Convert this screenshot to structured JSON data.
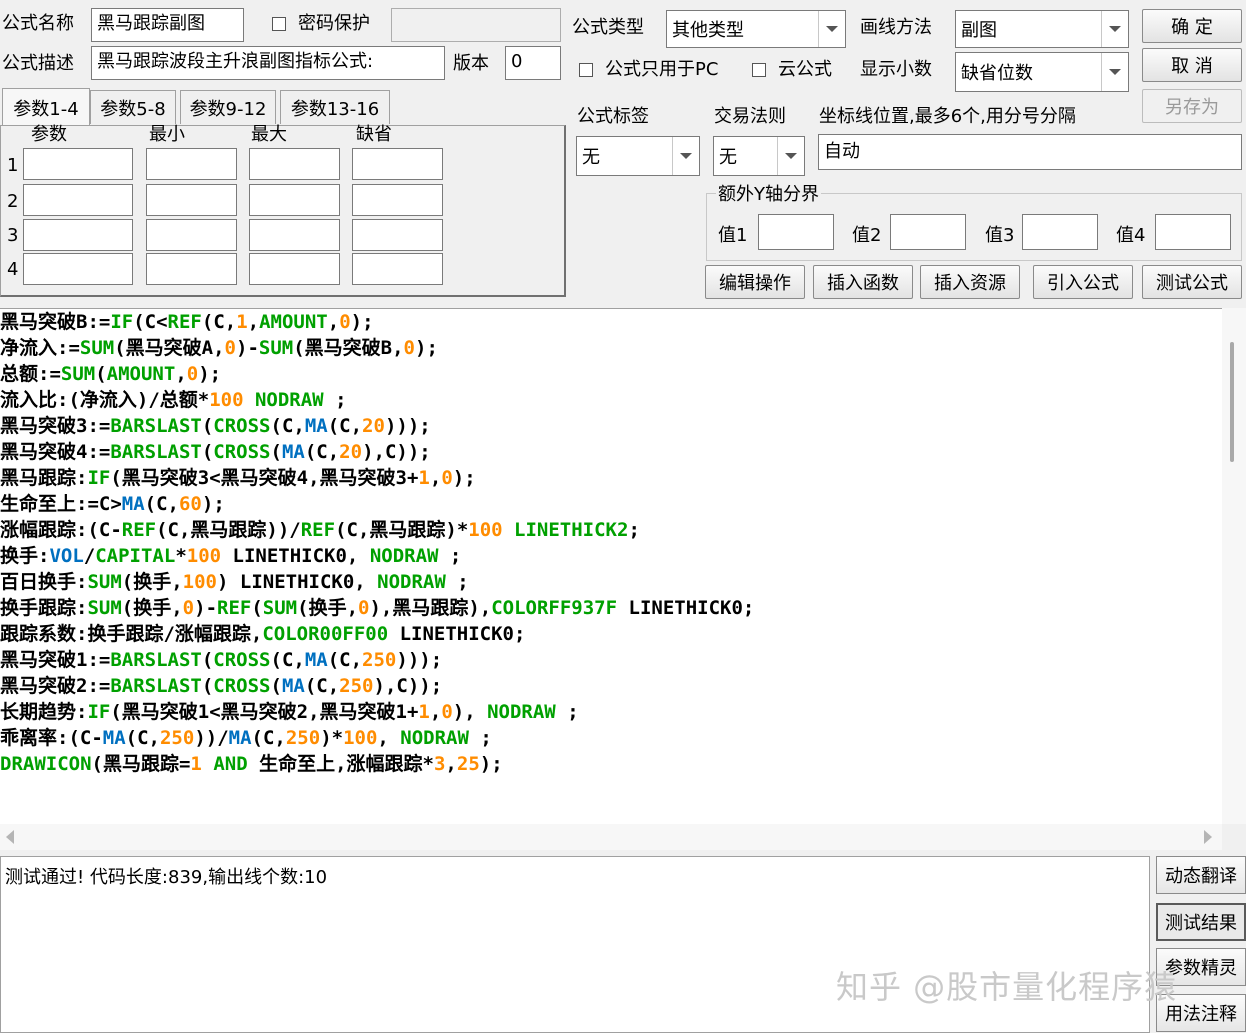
{
  "top": {
    "name_label": "公式名称",
    "name_value": "黑马跟踪副图",
    "password_label": "密码保护",
    "password_checked": false,
    "desc_label": "公式描述",
    "desc_value": "黑马跟踪波段主升浪副图指标公式:",
    "version_label": "版本",
    "version_value": "0",
    "type_label": "公式类型",
    "type_value": "其他类型",
    "draw_label": "画线方法",
    "draw_value": "副图",
    "pc_only_label": "公式只用于PC",
    "pc_only_checked": false,
    "cloud_label": "云公式",
    "cloud_checked": false,
    "decimal_label": "显示小数",
    "decimal_value": "缺省位数",
    "ok_label": "确  定",
    "cancel_label": "取  消",
    "saveas_label": "另存为"
  },
  "tabs": [
    "参数1-4",
    "参数5-8",
    "参数9-12",
    "参数13-16"
  ],
  "params": {
    "headers": [
      "参数",
      "最小",
      "最大",
      "缺省"
    ],
    "rows": [
      "1",
      "2",
      "3",
      "4"
    ]
  },
  "right": {
    "tag_label": "公式标签",
    "tag_value": "无",
    "rule_label": "交易法则",
    "rule_value": "无",
    "axis_label": "坐标线位置,最多6个,用分号分隔",
    "axis_value": "自动",
    "extra_y_label": "额外Y轴分界",
    "v1_label": "值1",
    "v2_label": "值2",
    "v3_label": "值3",
    "v4_label": "值4"
  },
  "actions": [
    "编辑操作",
    "插入函数",
    "插入资源",
    "引入公式",
    "测试公式"
  ],
  "colors": {
    "keyword": "#00a000",
    "number": "#ff8c00",
    "func_blue": "#0070c0",
    "text": "#000000"
  },
  "code": [
    [
      [
        "黑马突破B:=",
        "t"
      ],
      [
        "IF",
        "k"
      ],
      [
        "(C<",
        "t"
      ],
      [
        "REF",
        "k"
      ],
      [
        "(C,",
        "t"
      ],
      [
        "1",
        "n"
      ],
      [
        ",",
        "t"
      ],
      [
        "AMOUNT",
        "k"
      ],
      [
        ",",
        "t"
      ],
      [
        "0",
        "n"
      ],
      [
        ");",
        "t"
      ]
    ],
    [
      [
        "净流入:=",
        "t"
      ],
      [
        "SUM",
        "k"
      ],
      [
        "(黑马突破A,",
        "t"
      ],
      [
        "0",
        "n"
      ],
      [
        ")-",
        "t"
      ],
      [
        "SUM",
        "k"
      ],
      [
        "(黑马突破B,",
        "t"
      ],
      [
        "0",
        "n"
      ],
      [
        ");",
        "t"
      ]
    ],
    [
      [
        "总额:=",
        "t"
      ],
      [
        "SUM",
        "k"
      ],
      [
        "(",
        "t"
      ],
      [
        "AMOUNT",
        "k"
      ],
      [
        ",",
        "t"
      ],
      [
        "0",
        "n"
      ],
      [
        ");",
        "t"
      ]
    ],
    [
      [
        "流入比:(净流入)/总额*",
        "t"
      ],
      [
        "100",
        "n"
      ],
      [
        " ",
        "t"
      ],
      [
        "NODRAW",
        "k"
      ],
      [
        " ;",
        "t"
      ]
    ],
    [
      [
        "黑马突破3:=",
        "t"
      ],
      [
        "BARSLAST",
        "k"
      ],
      [
        "(",
        "t"
      ],
      [
        "CROSS",
        "k"
      ],
      [
        "(C,",
        "t"
      ],
      [
        "MA",
        "b"
      ],
      [
        "(C,",
        "t"
      ],
      [
        "20",
        "n"
      ],
      [
        ")));",
        "t"
      ]
    ],
    [
      [
        "黑马突破4:=",
        "t"
      ],
      [
        "BARSLAST",
        "k"
      ],
      [
        "(",
        "t"
      ],
      [
        "CROSS",
        "k"
      ],
      [
        "(",
        "t"
      ],
      [
        "MA",
        "b"
      ],
      [
        "(C,",
        "t"
      ],
      [
        "20",
        "n"
      ],
      [
        "),C));",
        "t"
      ]
    ],
    [
      [
        "黑马跟踪:",
        "t"
      ],
      [
        "IF",
        "k"
      ],
      [
        "(黑马突破3<黑马突破4,黑马突破3+",
        "t"
      ],
      [
        "1",
        "n"
      ],
      [
        ",",
        "t"
      ],
      [
        "0",
        "n"
      ],
      [
        ");",
        "t"
      ]
    ],
    [
      [
        "生命至上:=C>",
        "t"
      ],
      [
        "MA",
        "b"
      ],
      [
        "(C,",
        "t"
      ],
      [
        "60",
        "n"
      ],
      [
        ");",
        "t"
      ]
    ],
    [
      [
        "涨幅跟踪:(C-",
        "t"
      ],
      [
        "REF",
        "k"
      ],
      [
        "(C,黑马跟踪))/",
        "t"
      ],
      [
        "REF",
        "k"
      ],
      [
        "(C,黑马跟踪)*",
        "t"
      ],
      [
        "100",
        "n"
      ],
      [
        " ",
        "t"
      ],
      [
        "LINETHICK2",
        "k"
      ],
      [
        ";",
        "t"
      ]
    ],
    [
      [
        "换手:",
        "t"
      ],
      [
        "VOL",
        "b"
      ],
      [
        "/",
        "t"
      ],
      [
        "CAPITAL",
        "k"
      ],
      [
        "*",
        "t"
      ],
      [
        "100",
        "n"
      ],
      [
        " LINETHICK0, ",
        "t"
      ],
      [
        "NODRAW",
        "k"
      ],
      [
        " ;",
        "t"
      ]
    ],
    [
      [
        "百日换手:",
        "t"
      ],
      [
        "SUM",
        "k"
      ],
      [
        "(换手,",
        "t"
      ],
      [
        "100",
        "n"
      ],
      [
        ") LINETHICK0, ",
        "t"
      ],
      [
        "NODRAW",
        "k"
      ],
      [
        " ;",
        "t"
      ]
    ],
    [
      [
        "换手跟踪:",
        "t"
      ],
      [
        "SUM",
        "k"
      ],
      [
        "(换手,",
        "t"
      ],
      [
        "0",
        "n"
      ],
      [
        ")-",
        "t"
      ],
      [
        "REF",
        "k"
      ],
      [
        "(",
        "t"
      ],
      [
        "SUM",
        "k"
      ],
      [
        "(换手,",
        "t"
      ],
      [
        "0",
        "n"
      ],
      [
        "),黑马跟踪),",
        "t"
      ],
      [
        "COLORFF937F",
        "k"
      ],
      [
        " LINETHICK0;",
        "t"
      ]
    ],
    [
      [
        "跟踪系数:换手跟踪/涨幅跟踪,",
        "t"
      ],
      [
        "COLOR00FF00",
        "k"
      ],
      [
        " LINETHICK0;",
        "t"
      ]
    ],
    [
      [
        "黑马突破1:=",
        "t"
      ],
      [
        "BARSLAST",
        "k"
      ],
      [
        "(",
        "t"
      ],
      [
        "CROSS",
        "k"
      ],
      [
        "(C,",
        "t"
      ],
      [
        "MA",
        "b"
      ],
      [
        "(C,",
        "t"
      ],
      [
        "250",
        "n"
      ],
      [
        ")));",
        "t"
      ]
    ],
    [
      [
        "黑马突破2:=",
        "t"
      ],
      [
        "BARSLAST",
        "k"
      ],
      [
        "(",
        "t"
      ],
      [
        "CROSS",
        "k"
      ],
      [
        "(",
        "t"
      ],
      [
        "MA",
        "b"
      ],
      [
        "(C,",
        "t"
      ],
      [
        "250",
        "n"
      ],
      [
        "),C));",
        "t"
      ]
    ],
    [
      [
        "长期趋势:",
        "t"
      ],
      [
        "IF",
        "k"
      ],
      [
        "(黑马突破1<黑马突破2,黑马突破1+",
        "t"
      ],
      [
        "1",
        "n"
      ],
      [
        ",",
        "t"
      ],
      [
        "0",
        "n"
      ],
      [
        "), ",
        "t"
      ],
      [
        "NODRAW",
        "k"
      ],
      [
        " ;",
        "t"
      ]
    ],
    [
      [
        "乖离率:(C-",
        "t"
      ],
      [
        "MA",
        "b"
      ],
      [
        "(C,",
        "t"
      ],
      [
        "250",
        "n"
      ],
      [
        "))/",
        "t"
      ],
      [
        "MA",
        "b"
      ],
      [
        "(C,",
        "t"
      ],
      [
        "250",
        "n"
      ],
      [
        ")*",
        "t"
      ],
      [
        "100",
        "n"
      ],
      [
        ", ",
        "t"
      ],
      [
        "NODRAW",
        "k"
      ],
      [
        " ;",
        "t"
      ]
    ],
    [
      [
        "DRAWICON",
        "k"
      ],
      [
        "(黑马跟踪=",
        "t"
      ],
      [
        "1",
        "n"
      ],
      [
        " ",
        "t"
      ],
      [
        "AND",
        "k"
      ],
      [
        " 生命至上,涨幅跟踪*",
        "t"
      ],
      [
        "3",
        "n"
      ],
      [
        ",",
        "t"
      ],
      [
        "25",
        "n"
      ],
      [
        ");",
        "t"
      ]
    ]
  ],
  "output": {
    "message": "测试通过! 代码长度:839,输出线个数:10"
  },
  "side_buttons": [
    "动态翻译",
    "测试结果",
    "参数精灵",
    "用法注释"
  ],
  "watermark": "知乎 @股市量化程序猿"
}
